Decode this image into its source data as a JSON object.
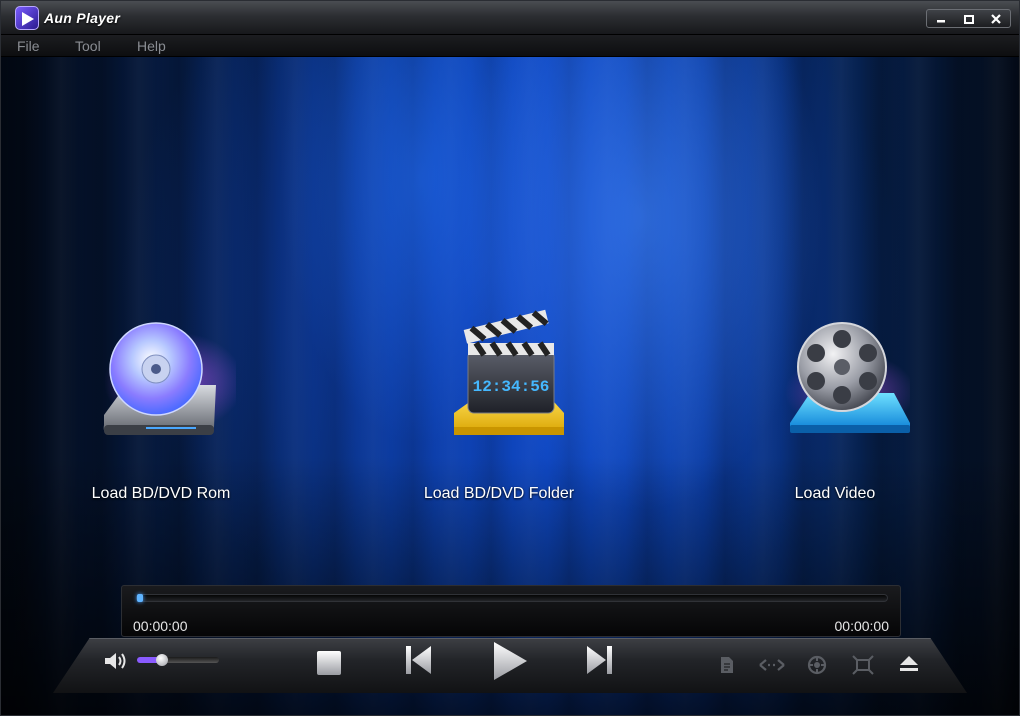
{
  "window": {
    "title": "Aun Player"
  },
  "titlebar_controls": {
    "minimize": "▬",
    "maximize": "▢",
    "close": "✕"
  },
  "menu": [
    "File",
    "Tool",
    "Help"
  ],
  "loaders": [
    {
      "label": "Load BD/DVD Rom",
      "icon": "disc-drive-icon"
    },
    {
      "label": "Load BD/DVD Folder",
      "icon": "clapperboard-folder-icon",
      "clock_text": "12:34:56"
    },
    {
      "label": "Load Video",
      "icon": "film-reel-icon"
    }
  ],
  "playback": {
    "elapsed": "00:00:00",
    "total": "00:00:00",
    "progress": 0,
    "volume": 0.3
  },
  "colors": {
    "accent": "#8a5bff",
    "seek": "#5fb4ff",
    "menu_text": "#8a8d93"
  }
}
